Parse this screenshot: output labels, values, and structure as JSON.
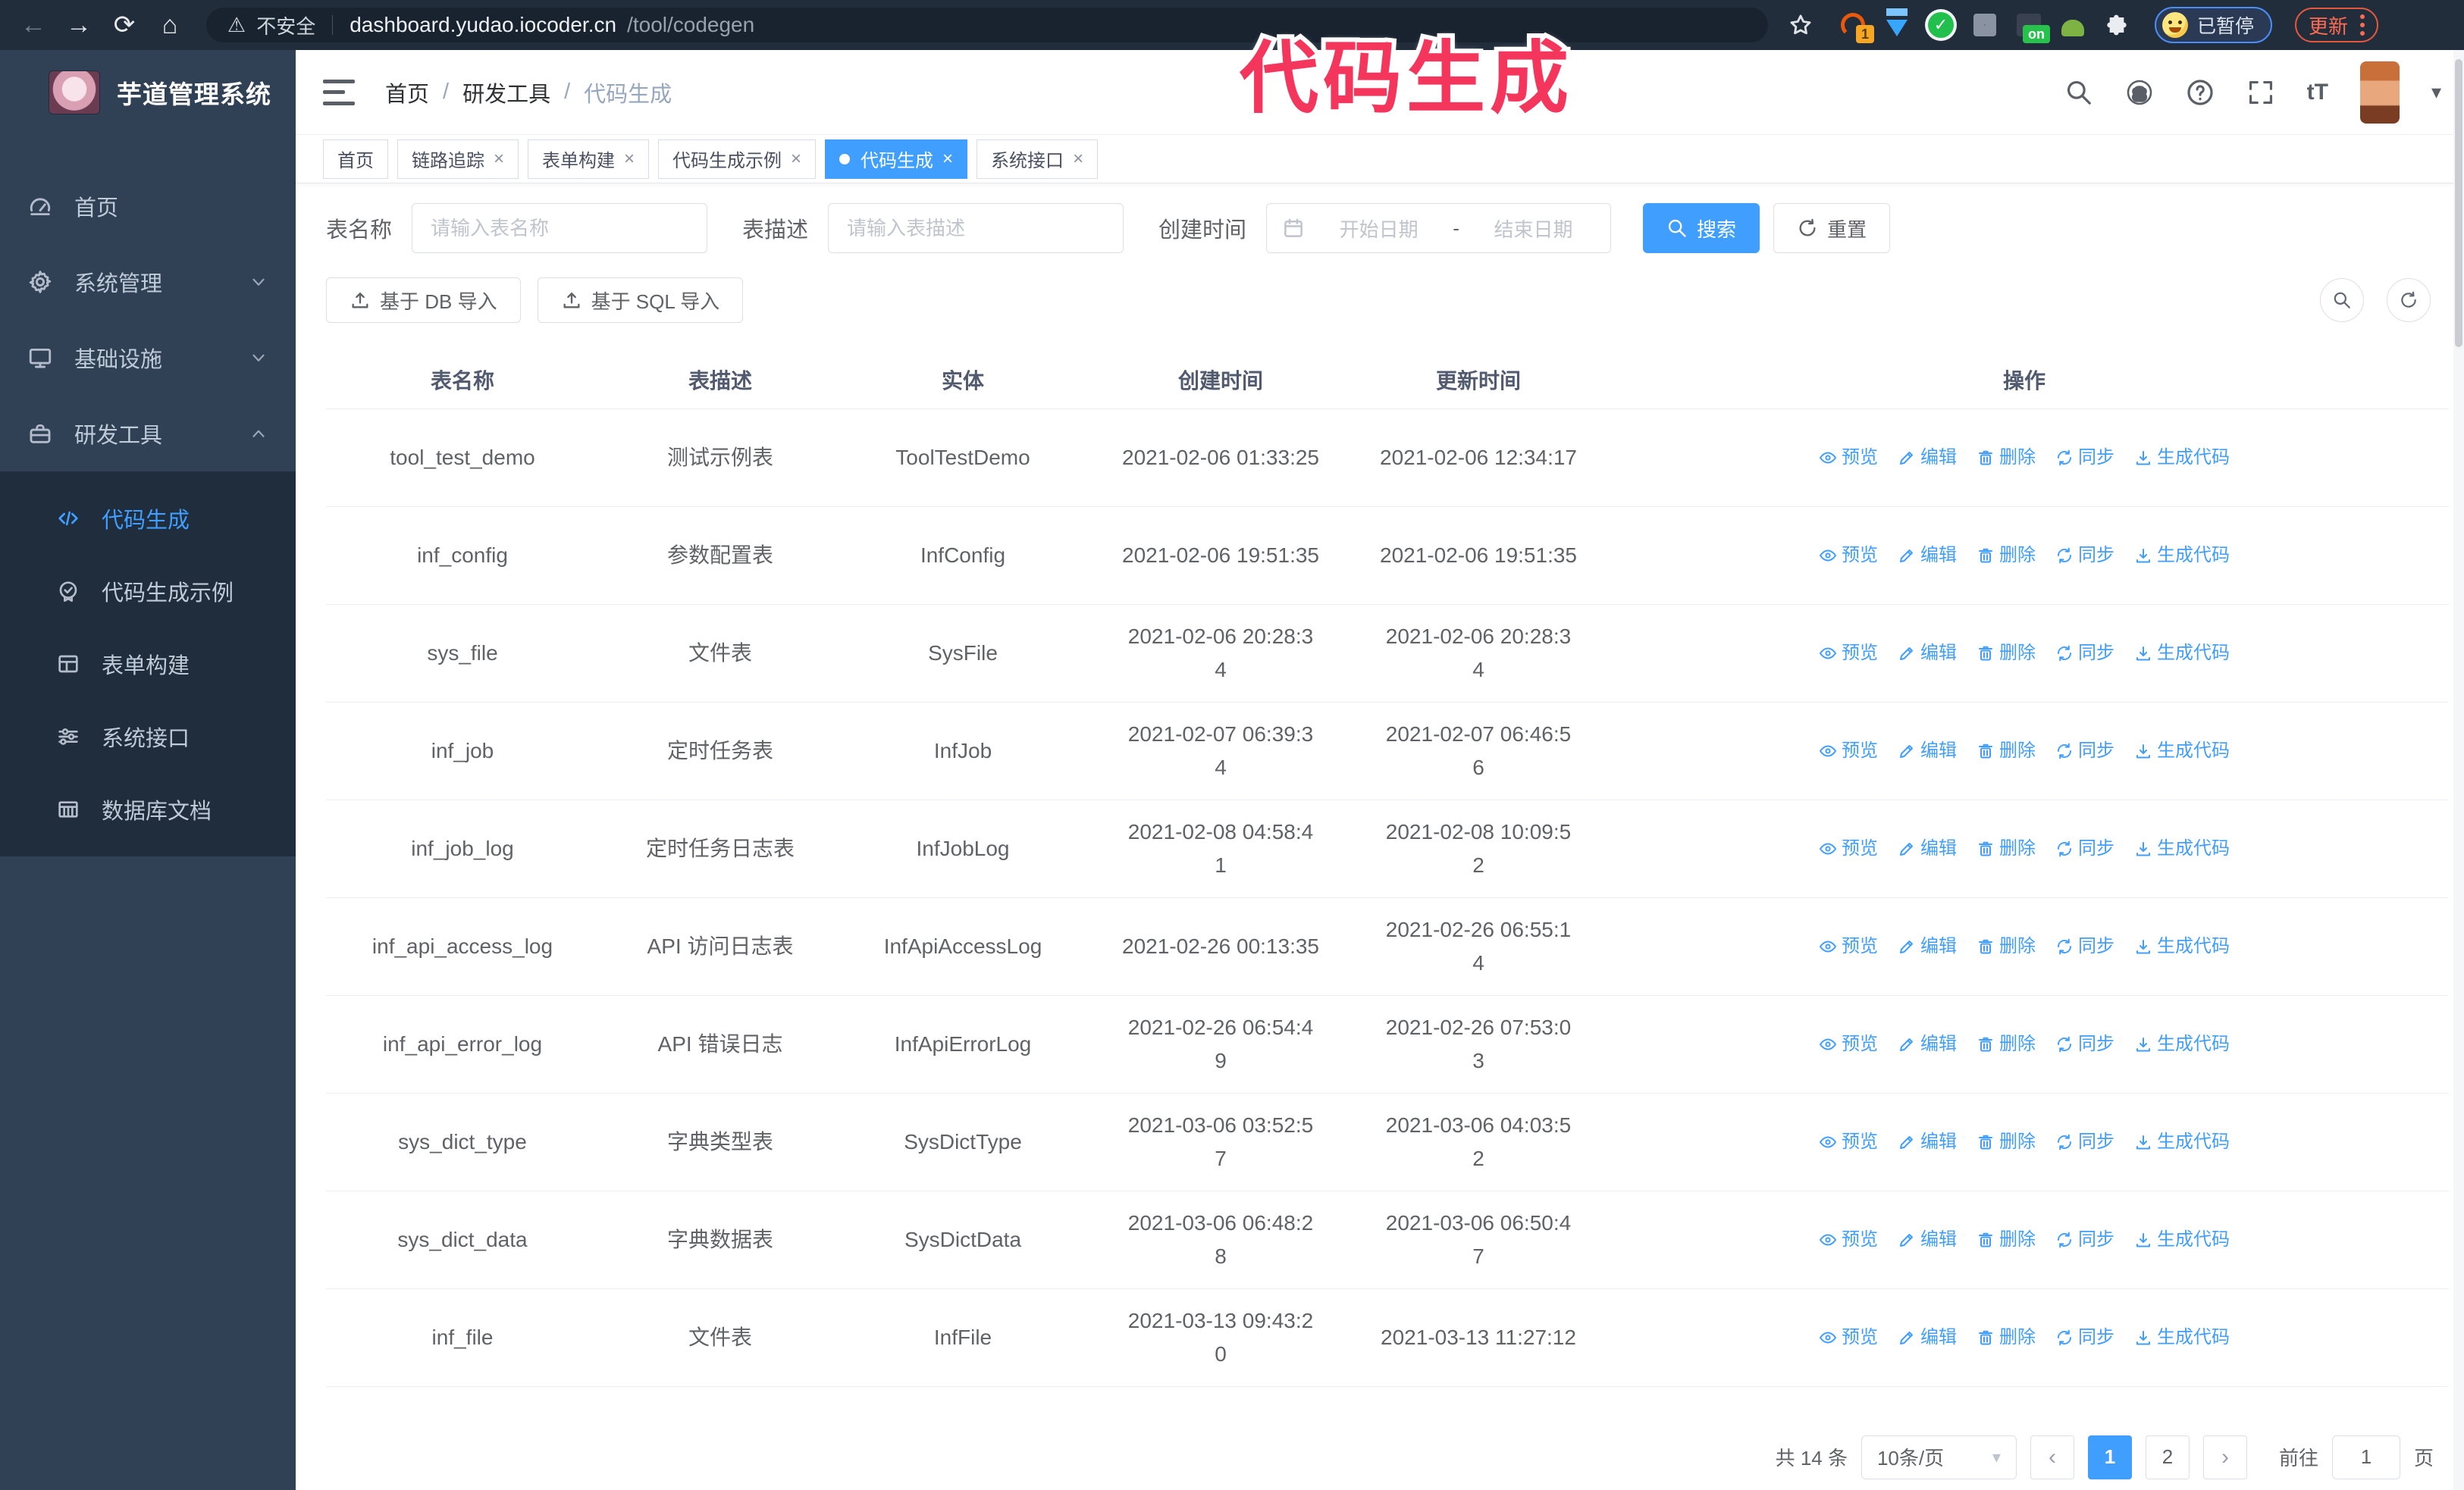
{
  "overlay": {
    "title": "代码生成",
    "color": "#f5365c"
  },
  "browser": {
    "security_label": "不安全",
    "url_host": "dashboard.yudao.iocoder.cn",
    "url_path": "/tool/codegen",
    "extension_badge": "1",
    "extension_on_badge": "on",
    "paused_badge": "已暂停",
    "update_button": "更新"
  },
  "sidebar": {
    "logo_title": "芋道管理系统",
    "items": [
      {
        "label": "首页",
        "icon": "dashboard-icon"
      },
      {
        "label": "系统管理",
        "icon": "gear-icon"
      },
      {
        "label": "基础设施",
        "icon": "monitor-icon"
      },
      {
        "label": "研发工具",
        "icon": "toolbox-icon"
      }
    ],
    "submenu": [
      {
        "label": "代码生成",
        "icon": "code-icon"
      },
      {
        "label": "代码生成示例",
        "icon": "badge-check-icon"
      },
      {
        "label": "表单构建",
        "icon": "form-icon"
      },
      {
        "label": "系统接口",
        "icon": "sliders-icon"
      },
      {
        "label": "数据库文档",
        "icon": "database-doc-icon"
      }
    ]
  },
  "navbar": {
    "breadcrumb": [
      "首页",
      "研发工具",
      "代码生成"
    ]
  },
  "tabs": [
    {
      "label": "首页"
    },
    {
      "label": "链路追踪"
    },
    {
      "label": "表单构建"
    },
    {
      "label": "代码生成示例"
    },
    {
      "label": "代码生成"
    },
    {
      "label": "系统接口"
    }
  ],
  "search": {
    "name_label": "表名称",
    "name_placeholder": "请输入表名称",
    "desc_label": "表描述",
    "desc_placeholder": "请输入表描述",
    "time_label": "创建时间",
    "start_placeholder": "开始日期",
    "separator": "-",
    "end_placeholder": "结束日期",
    "search_button": "搜索",
    "reset_button": "重置"
  },
  "toolbar": {
    "import_db": "基于 DB 导入",
    "import_sql": "基于 SQL 导入"
  },
  "table": {
    "columns": [
      "表名称",
      "表描述",
      "实体",
      "创建时间",
      "更新时间",
      "操作"
    ],
    "actions": [
      "预览",
      "编辑",
      "删除",
      "同步",
      "生成代码"
    ],
    "rows": [
      {
        "name": "tool_test_demo",
        "desc": "测试示例表",
        "entity": "ToolTestDemo",
        "created": "2021-02-06 01:33:25",
        "updated": "2021-02-06 12:34:17",
        "created_wrapped": false,
        "updated_wrapped": false
      },
      {
        "name": "inf_config",
        "desc": "参数配置表",
        "entity": "InfConfig",
        "created": "2021-02-06 19:51:35",
        "updated": "2021-02-06 19:51:35",
        "created_wrapped": false,
        "updated_wrapped": false
      },
      {
        "name": "sys_file",
        "desc": "文件表",
        "entity": "SysFile",
        "created": "2021-02-06 20:28:34",
        "updated": "2021-02-06 20:28:34",
        "created_wrapped": true,
        "updated_wrapped": true
      },
      {
        "name": "inf_job",
        "desc": "定时任务表",
        "entity": "InfJob",
        "created": "2021-02-07 06:39:34",
        "updated": "2021-02-07 06:46:56",
        "created_wrapped": true,
        "updated_wrapped": true
      },
      {
        "name": "inf_job_log",
        "desc": "定时任务日志表",
        "entity": "InfJobLog",
        "created": "2021-02-08 04:58:41",
        "updated": "2021-02-08 10:09:52",
        "created_wrapped": true,
        "updated_wrapped": true
      },
      {
        "name": "inf_api_access_log",
        "desc": "API 访问日志表",
        "entity": "InfApiAccessLog",
        "created": "2021-02-26 00:13:35",
        "updated": "2021-02-26 06:55:14",
        "created_wrapped": false,
        "updated_wrapped": true
      },
      {
        "name": "inf_api_error_log",
        "desc": "API 错误日志",
        "entity": "InfApiErrorLog",
        "created": "2021-02-26 06:54:49",
        "updated": "2021-02-26 07:53:03",
        "created_wrapped": true,
        "updated_wrapped": true
      },
      {
        "name": "sys_dict_type",
        "desc": "字典类型表",
        "entity": "SysDictType",
        "created": "2021-03-06 03:52:57",
        "updated": "2021-03-06 04:03:52",
        "created_wrapped": true,
        "updated_wrapped": true
      },
      {
        "name": "sys_dict_data",
        "desc": "字典数据表",
        "entity": "SysDictData",
        "created": "2021-03-06 06:48:28",
        "updated": "2021-03-06 06:50:47",
        "created_wrapped": true,
        "updated_wrapped": true
      },
      {
        "name": "inf_file",
        "desc": "文件表",
        "entity": "InfFile",
        "created": "2021-03-13 09:43:20",
        "updated": "2021-03-13 11:27:12",
        "created_wrapped": true,
        "updated_wrapped": false
      }
    ]
  },
  "pagination": {
    "total": "共 14 条",
    "page_size": "10条/页",
    "pages": [
      "1",
      "2"
    ],
    "active_page": "1",
    "goto_label": "前往",
    "goto_value": "1",
    "page_suffix": "页"
  },
  "colors": {
    "primary": "#409eff",
    "sidebar_bg": "#304156",
    "submenu_bg": "#1f2d3d",
    "overlay": "#f5365c"
  }
}
